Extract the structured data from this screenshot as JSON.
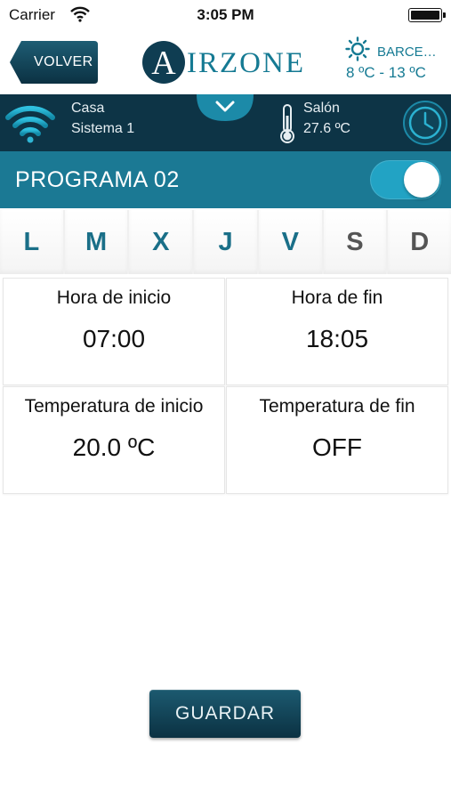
{
  "status_bar": {
    "carrier": "Carrier",
    "time": "3:05 PM"
  },
  "header": {
    "back_label": "VOLVER",
    "logo": {
      "initial": "A",
      "rest": "IRZONE"
    },
    "weather": {
      "icon": "sun-icon",
      "city": "BARCE…",
      "temp_range": "8 ºC - 13 ºC"
    }
  },
  "system_bar": {
    "icon": "wifi-icon",
    "home": "Casa",
    "system": "Sistema 1",
    "zone_icon": "thermometer-icon",
    "zone": "Salón",
    "zone_temp": "27.6 ºC"
  },
  "program": {
    "title": "PROGRAMA 02",
    "enabled": true
  },
  "days": [
    {
      "label": "L",
      "active": true
    },
    {
      "label": "M",
      "active": true
    },
    {
      "label": "X",
      "active": true
    },
    {
      "label": "J",
      "active": true
    },
    {
      "label": "V",
      "active": true
    },
    {
      "label": "S",
      "active": false
    },
    {
      "label": "D",
      "active": false
    }
  ],
  "schedule": {
    "start_time_label": "Hora de inicio",
    "start_time": "07:00",
    "end_time_label": "Hora de fin",
    "end_time": "18:05",
    "start_temp_label": "Temperatura de inicio",
    "start_temp": "20.0 ºC",
    "end_temp_label": "Temperatura de fin",
    "end_temp": "OFF"
  },
  "actions": {
    "save_label": "GUARDAR"
  },
  "colors": {
    "brand_dark": "#0d3446",
    "brand_teal": "#1b7994",
    "accent": "#157a93",
    "toggle_on": "#22a3c4"
  }
}
